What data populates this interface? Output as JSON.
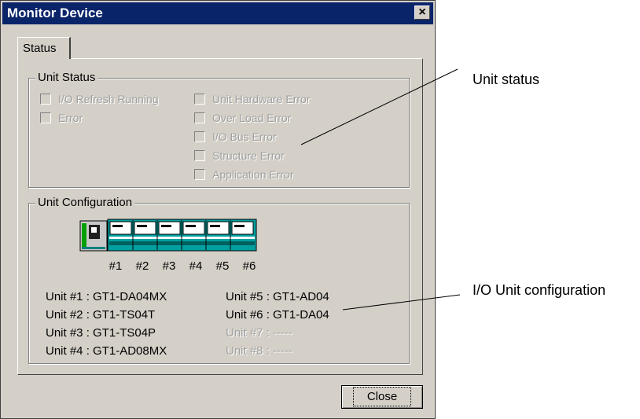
{
  "window": {
    "title": "Monitor Device",
    "close_glyph": "×"
  },
  "tab": {
    "label": "Status"
  },
  "unit_status": {
    "title": "Unit Status",
    "left": [
      "I/O Refresh Running",
      "Error"
    ],
    "right": [
      "Unit Hardware Error",
      "Over Load Error",
      "I/O Bus Error",
      "Structure Error",
      "Application Error"
    ]
  },
  "unit_config": {
    "title": "Unit Configuration",
    "slot_numbers": [
      "#1",
      "#2",
      "#3",
      "#4",
      "#5",
      "#6"
    ],
    "units_left": [
      "Unit #1 : GT1-DA04MX",
      "Unit #2 : GT1-TS04T",
      "Unit #3 : GT1-TS04P",
      "Unit #4 : GT1-AD08MX"
    ],
    "units_right": [
      "Unit #5 :  GT1-AD04",
      "Unit #6 :  GT1-DA04",
      "Unit #7 :  -----",
      "Unit #8 :  -----"
    ]
  },
  "buttons": {
    "close": "Close"
  },
  "callouts": {
    "unit_status": "Unit status",
    "io_config": "I/O Unit configuration"
  }
}
